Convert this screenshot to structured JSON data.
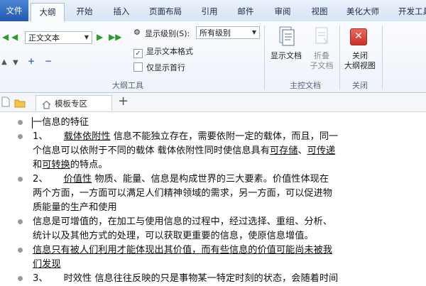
{
  "tabs": [
    "文件",
    "大纲",
    "开始",
    "插入",
    "页面布局",
    "引用",
    "邮件",
    "审阅",
    "视图",
    "美化大师",
    "开发工具"
  ],
  "ribbon": {
    "outline_level_value": "正文文本",
    "show_level_label": "显示级别(S):",
    "show_level_value": "所有级别",
    "show_text_format_label": "显示文本格式",
    "show_first_line_label": "仅显示首行",
    "group_outline_tools": "大纲工具",
    "show_doc_label": "显示文档",
    "collapse_doc_label_1": "折叠",
    "collapse_doc_label_2": "子文档",
    "group_master_doc": "主控文档",
    "close_label_1": "关闭",
    "close_label_2": "大纲视图",
    "group_close": "关闭"
  },
  "doc_tabs": {
    "template_tab": "模板专区",
    "new_tab": "+"
  },
  "document": {
    "lines": [
      {
        "segments": [
          {
            "text": "一信息的特征",
            "u": false
          }
        ]
      },
      {
        "segments": [
          {
            "text": "1、",
            "u": false
          },
          {
            "text": "载体依附性",
            "u": true
          },
          {
            "text": " 信息不能独立存在，需要依附一定的载体，而且，同一",
            "u": false
          }
        ]
      },
      {
        "segments": [
          {
            "text": "个信息可以依附于不同的载体  载体依附性同时使信息具有",
            "u": false
          },
          {
            "text": "可存储",
            "u": true
          },
          {
            "text": "、",
            "u": false
          },
          {
            "text": "可传递",
            "u": true
          }
        ]
      },
      {
        "segments": [
          {
            "text": "和",
            "u": false
          },
          {
            "text": "可转换",
            "u": true
          },
          {
            "text": "的特点。",
            "u": false
          }
        ]
      },
      {
        "segments": [
          {
            "text": "2、",
            "u": false
          },
          {
            "text": "价值性",
            "u": true
          },
          {
            "text": "   物质、能量、信息是构成世界的三大要素。价值性体现在",
            "u": false
          }
        ]
      },
      {
        "segments": [
          {
            "text": "两个方面，一方面可以满足人们精神领域的需求，另一方面，可以促进物",
            "u": false
          }
        ]
      },
      {
        "segments": [
          {
            "text": "质能量的生产和使用",
            "u": false
          }
        ]
      },
      {
        "segments": [
          {
            "text": "信息是可增值的，在加工与使用信息的过程中，经过选择、重组、分析、",
            "u": false
          }
        ]
      },
      {
        "segments": [
          {
            "text": "统计以及其他方式的处理，可以获取更重要的信息，使原信息增值。",
            "u": false
          }
        ]
      },
      {
        "segments": [
          {
            "text": "信息只有被人们利用才能体现出其价值，而有些信息的价值可能尚未被我",
            "u": true
          }
        ]
      },
      {
        "segments": [
          {
            "text": "们发现",
            "u": true
          }
        ]
      },
      {
        "segments": [
          {
            "text": "3、",
            "u": false
          },
          {
            "text": "时效性",
            "u": false
          },
          {
            "text": " 信息往往反映的只是事物某一特定时刻的状态，会随着时间",
            "u": false
          }
        ]
      }
    ]
  }
}
